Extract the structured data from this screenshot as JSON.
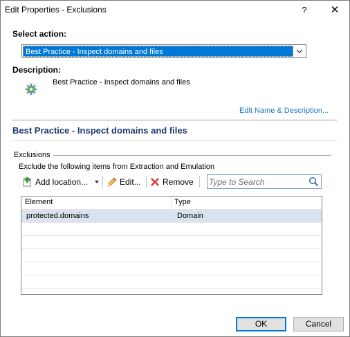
{
  "window": {
    "title": "Edit Properties - Exclusions",
    "help_label": "?",
    "close_label": "✕"
  },
  "action": {
    "label": "Select action:",
    "selected_value": "Best Practice - Inspect domains and files",
    "highlight_color": "#0078d7"
  },
  "description": {
    "label": "Description:",
    "icon": "settings-gear-icon",
    "text": "Best Practice - Inspect domains and files",
    "edit_link": "Edit Name & Description..."
  },
  "section": {
    "title": "Best Practice - Inspect domains and files",
    "title_color": "#1f3a70"
  },
  "exclusions": {
    "group_label": "Exclusions",
    "description": "Exclude the following items from Extraction and Emulation",
    "toolbar": {
      "add_label": "Add location...",
      "add_icon": "add-icon",
      "edit_label": "Edit...",
      "edit_icon": "pencil-icon",
      "remove_label": "Remove",
      "remove_icon": "x-icon"
    },
    "search": {
      "placeholder": "Type to Search",
      "icon": "search-icon"
    },
    "table": {
      "columns": [
        "Element",
        "Type"
      ],
      "rows": [
        [
          "protected.domains",
          "Domain"
        ]
      ],
      "selected_row_color": "#d9e2ee"
    }
  },
  "footer": {
    "ok_label": "OK",
    "cancel_label": "Cancel"
  }
}
